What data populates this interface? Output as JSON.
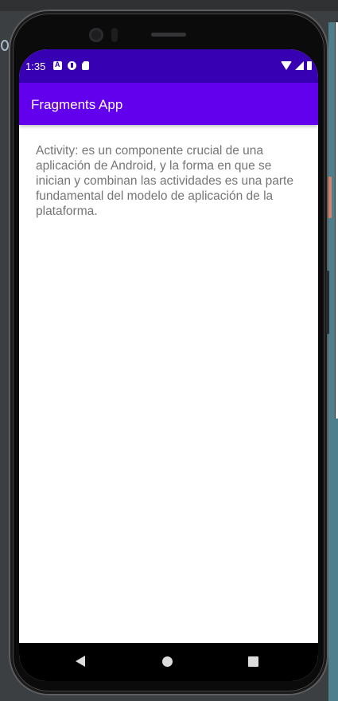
{
  "status_bar": {
    "time": "1:35",
    "left_icons": [
      "a-notification-icon",
      "circle-notification-icon",
      "sd-card-icon"
    ],
    "right_icons": [
      "wifi-icon",
      "signal-icon",
      "battery-icon"
    ],
    "background": "#3700b3"
  },
  "app_bar": {
    "title": "Fragments App",
    "background": "#6200ee"
  },
  "content": {
    "text": "Activity: es un componente crucial de una aplicación de Android, y la forma en que se inician y combinan las actividades es una parte fundamental del modelo de aplicación de la plataforma."
  },
  "nav_bar": {
    "buttons": [
      "back",
      "home",
      "recents"
    ]
  }
}
